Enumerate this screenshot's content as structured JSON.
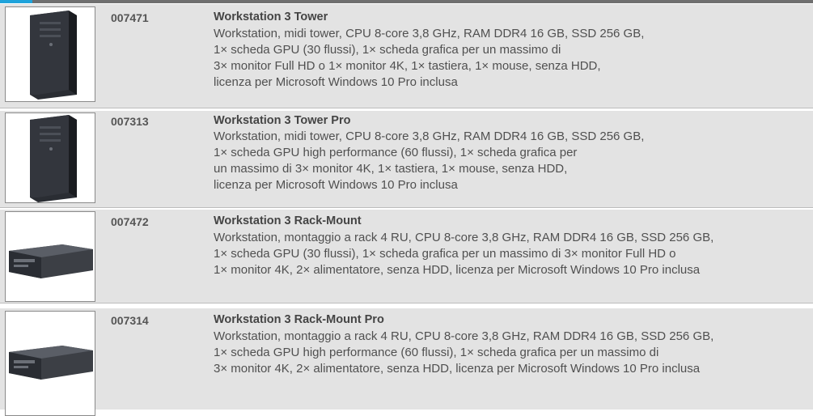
{
  "products": [
    {
      "code": "007471",
      "title": "Workstation 3 Tower",
      "image": "tower-workstation-icon",
      "lines": [
        "Workstation, midi tower, CPU 8-core 3,8 GHz, RAM DDR4 16 GB, SSD 256 GB,",
        "1× scheda GPU (30 flussi), 1× scheda grafica per un massimo di",
        "3× monitor Full HD o 1× monitor 4K, 1× tastiera, 1× mouse, senza HDD,",
        "licenza per Microsoft Windows 10 Pro inclusa"
      ]
    },
    {
      "code": "007313",
      "title": "Workstation 3 Tower Pro",
      "image": "tower-workstation-icon",
      "lines": [
        "Workstation, midi tower, CPU 8-core 3,8 GHz, RAM DDR4 16 GB, SSD 256 GB,",
        "1× scheda GPU high performance (60 flussi), 1× scheda grafica per",
        "un massimo di 3× monitor 4K, 1× tastiera, 1× mouse, senza HDD,",
        "licenza per Microsoft Windows 10 Pro inclusa"
      ]
    },
    {
      "code": "007472",
      "title": "Workstation 3 Rack-Mount",
      "image": "rack-workstation-icon",
      "lines": [
        "Workstation, montaggio a rack 4 RU, CPU 8-core 3,8 GHz, RAM DDR4 16 GB, SSD 256 GB,",
        "1× scheda GPU (30 flussi), 1× scheda grafica per un massimo di 3× monitor Full HD o",
        "1× monitor 4K, 2× alimentatore, senza HDD, licenza per Microsoft Windows 10 Pro inclusa"
      ]
    },
    {
      "code": "007314",
      "title": "Workstation 3 Rack-Mount Pro",
      "image": "rack-workstation-icon",
      "lines": [
        "Workstation, montaggio a rack 4 RU, CPU 8-core 3,8 GHz, RAM DDR4 16 GB, SSD 256 GB,",
        "1× scheda GPU high performance (60 flussi), 1× scheda grafica per un massimo di",
        "3× monitor 4K, 2× alimentatore, senza HDD, licenza per Microsoft Windows 10 Pro inclusa"
      ]
    }
  ],
  "colors": {
    "accent": "#1fa3db",
    "shade": "#e3e3e3",
    "text": "#505050"
  }
}
